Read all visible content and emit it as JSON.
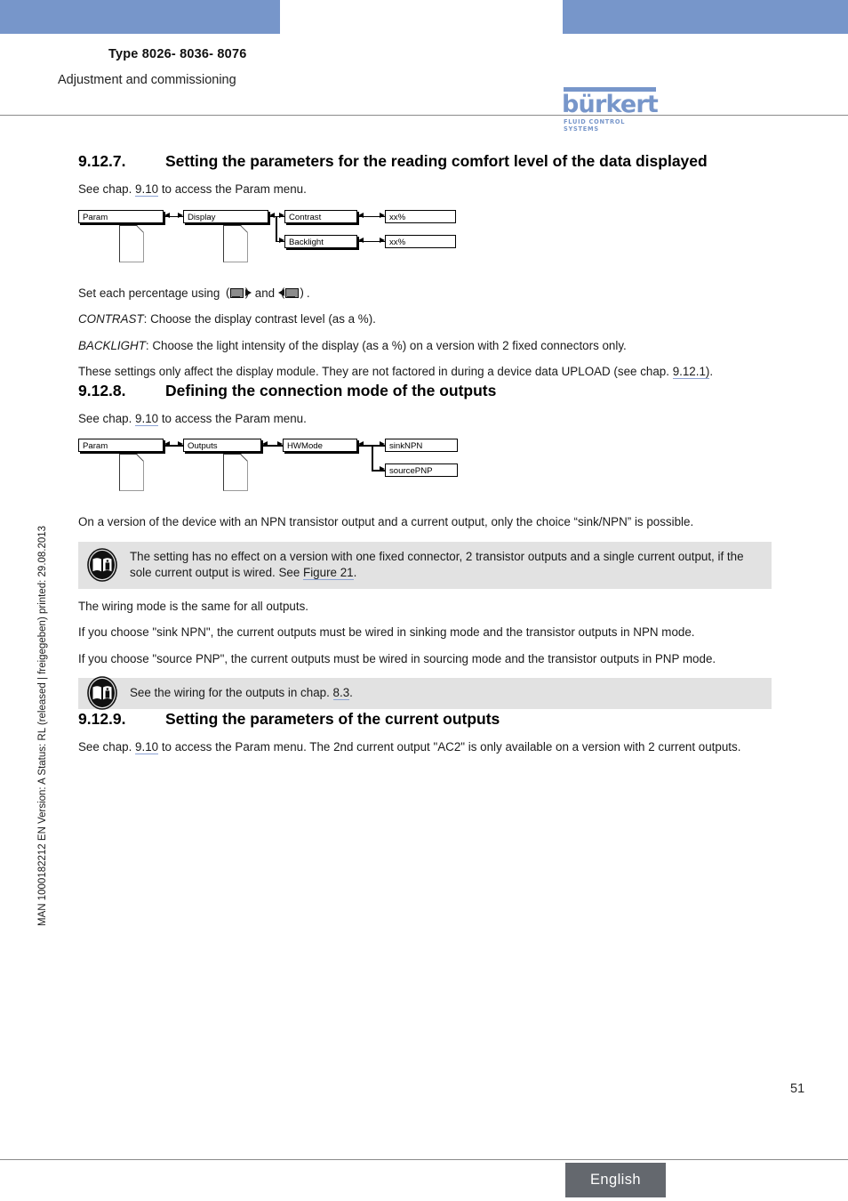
{
  "header": {
    "title": "Type 8026- 8036- 8076",
    "subtitle": "Adjustment and commissioning",
    "logo_word": "bürkert",
    "logo_tagline": "FLUID CONTROL SYSTEMS"
  },
  "margin_note": "MAN 1000182212  EN  Version: A  Status: RL (released | freigegeben)  printed: 29.08.2013",
  "sections": {
    "s1": {
      "number": "9.12.7.",
      "title": "Setting the parameters for the reading comfort level of the data displayed",
      "intro_pre": "See chap. ",
      "intro_link": "9.10",
      "intro_post": " to access the Param menu.",
      "set_pre": "Set each percentage using ",
      "set_mid": " and ",
      "set_post": ".",
      "contrast_label": "CONTRAST",
      "contrast_text": ": Choose the display contrast level (as a %).",
      "backlight_label": "BACKLIGHT",
      "backlight_text": ": Choose the light intensity of the display (as a %) on a version with 2 fixed connectors only.",
      "upload_pre": "These settings only affect the display module. They are not factored in during a device data UPLOAD (see chap. ",
      "upload_link": "9.12.1)",
      "upload_post": "."
    },
    "s2": {
      "number": "9.12.8.",
      "title": "Defining the connection mode of the outputs",
      "intro_pre": "See chap. ",
      "intro_link": "9.10",
      "intro_post": " to access the Param menu.",
      "npn_note": "On a version of the device with an NPN transistor output and a current output, only the choice “sink/NPN” is possible.",
      "note1_pre": "The setting has no effect on a version with one fixed connector, 2 transistor outputs and a single current output, if the sole current output is wired. See ",
      "note1_link": "Figure 21",
      "note1_post": ".",
      "wiring_same": "The wiring mode is the same for all outputs.",
      "sink_text": "If you choose \"sink NPN\", the current outputs must be wired in sinking mode and the transistor outputs in NPN mode.",
      "source_text": "If you choose \"source PNP\", the current outputs must be wired in sourcing mode and the transistor outputs in PNP mode.",
      "note2_pre": "See the wiring for the outputs in chap. ",
      "note2_link": "8.3",
      "note2_post": "."
    },
    "s3": {
      "number": "9.12.9.",
      "title": "Setting the parameters of the current outputs",
      "intro_pre": "See chap. ",
      "intro_link": "9.10",
      "intro_post": " to access the Param menu. The 2nd current output \"AC2\" is only available on a version with 2 current outputs."
    }
  },
  "diagram1": {
    "type": "menu-flow",
    "boxes": {
      "param": "Param",
      "display": "Display",
      "contrast": "Contrast",
      "contrast_value": "xx%",
      "backlight": "Backlight",
      "backlight_value": "xx%"
    }
  },
  "diagram2": {
    "type": "menu-flow",
    "boxes": {
      "param": "Param",
      "outputs": "Outputs",
      "hwmode": "HWMode",
      "sinknpn": "sinkNPN",
      "sourcepnp": "sourcePNP"
    }
  },
  "footer": {
    "page_number": "51",
    "language": "English"
  },
  "colors": {
    "brand_blue": "#7796ca",
    "note_gray": "#e2e2e2",
    "footer_gray": "#64686e",
    "link_underline": "#8ba2d4"
  }
}
